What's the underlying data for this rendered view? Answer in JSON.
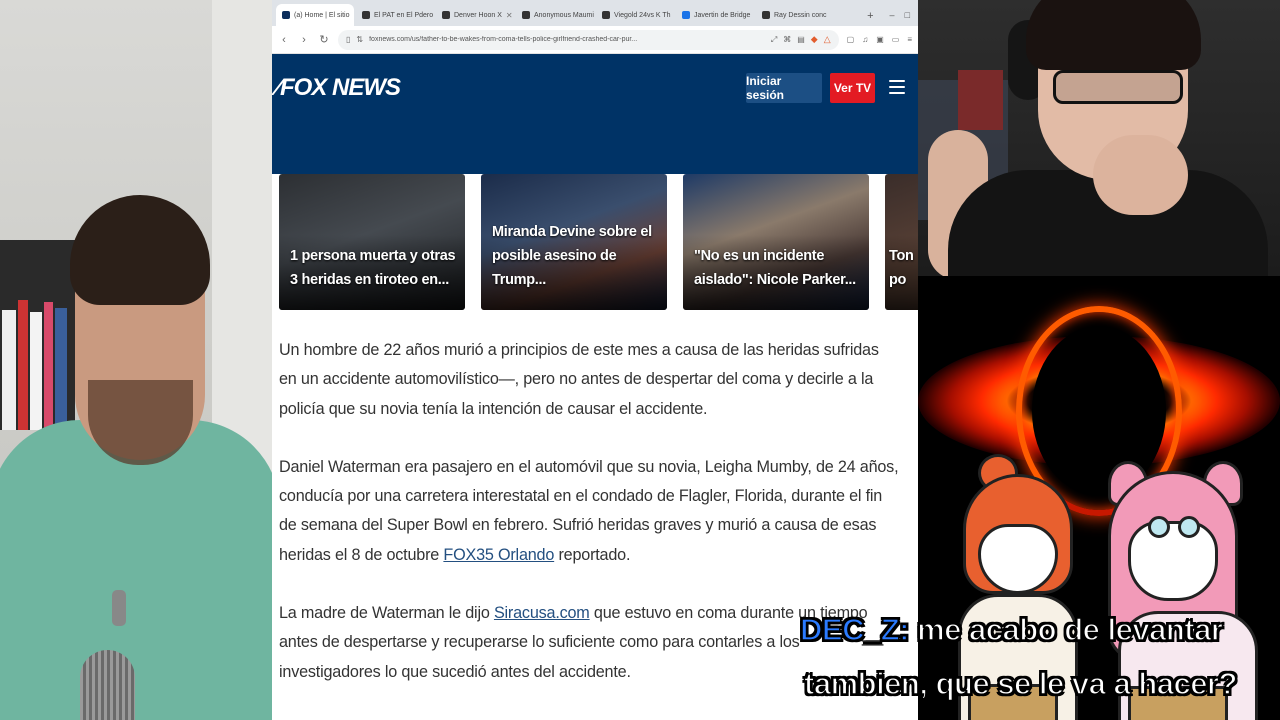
{
  "browser": {
    "tabs": [
      {
        "label": "(a) Home | El sitio",
        "active": true,
        "icon": "fox"
      },
      {
        "label": "El PAT en El Pdero",
        "active": false,
        "icon": "dark"
      },
      {
        "label": "Denver Hoon X",
        "active": false,
        "icon": "dark"
      },
      {
        "label": "Anonymous Maumi",
        "active": false,
        "icon": "dark"
      },
      {
        "label": "Viegold 24vs K Th",
        "active": false,
        "icon": "dark"
      },
      {
        "label": "Javertin de Bridge",
        "active": false,
        "icon": "blue"
      },
      {
        "label": "Ray Dessin conc",
        "active": false,
        "icon": "dark"
      }
    ],
    "url": "foxnews.com/us/father-to-be-wakes-from-coma-tells-police-girlfriend-crashed-car-pur..."
  },
  "site": {
    "logo": "FOX NEWS",
    "login_label": "Iniciar sesión",
    "watch_label": "Ver TV",
    "brand_colors": {
      "header": "#003366",
      "login": "#1c4f84",
      "watch": "#e31b23"
    }
  },
  "carousel": [
    {
      "caption": "1 persona muerta y otras 3 heridas en tiroteo en..."
    },
    {
      "caption": "Miranda Devine sobre el posible asesino de Trump..."
    },
    {
      "caption": "\"No es un incidente aislado\": Nicole Parker..."
    },
    {
      "caption": "Ton po"
    }
  ],
  "article": {
    "p1": "Un hombre de 22 años murió a principios de este mes a causa de las heridas sufridas en un accidente automovilístico—, pero no antes de despertar del coma y decirle a la policía que su novia tenía la intención de causar el accidente.",
    "p2_pre": "Daniel Waterman era pasajero en el automóvil que su novia, Leigha Mumby, de 24 años, conducía por una carretera interestatal en el condado de Flagler, Florida, durante el fin de semana del Super Bowl en febrero. Sufrió heridas graves y murió a causa de esas heridas el 8 de octubre ",
    "p2_link": "FOX35 Orlando",
    "p2_post": " reportado.",
    "p3_pre": "La madre de Waterman le dijo ",
    "p3_link": "Siracusa.com",
    "p3_post": " que estuvo en coma durante un tiempo antes de despertarse y recuperarse lo suficiente como para contarles a los investigadores lo que sucedió antes del accidente."
  },
  "chat": {
    "user": "DEC_Z:",
    "line1": " me acabo de levantar",
    "line2": "tambien, que se le va a hacer?"
  }
}
